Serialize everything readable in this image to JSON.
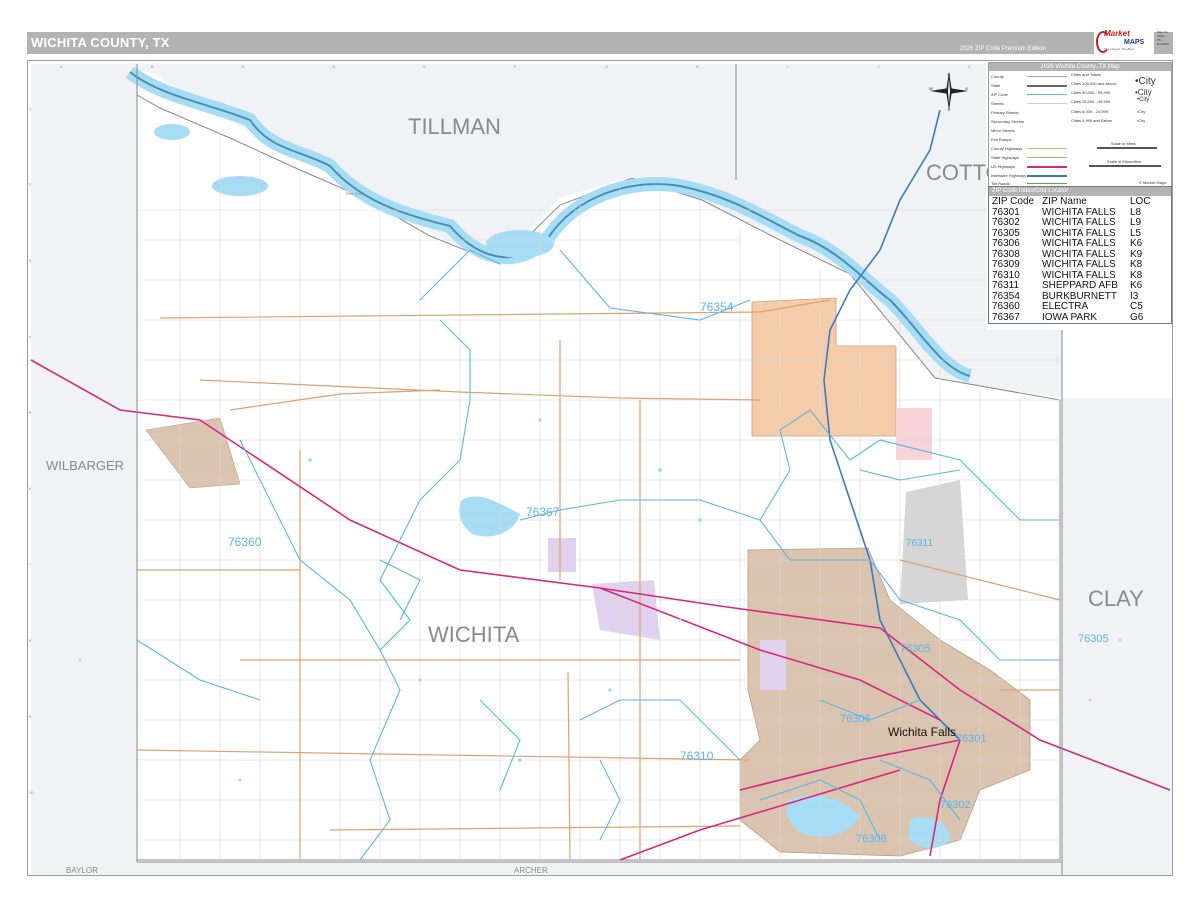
{
  "header": {
    "title": "WICHITA COUNTY, TX",
    "subtitle": "2026 ZIP Code Premium Edition"
  },
  "logo": {
    "word": "Market",
    "maps": "MAPS",
    "tagline": "The Largest. The Best."
  },
  "corner_note": [
    "Map No.",
    "Order",
    "Ph",
    "D-12450"
  ],
  "map": {
    "counties": [
      {
        "name": "TILLMAN",
        "size": 22
      },
      {
        "name": "COTTO",
        "size": 22
      },
      {
        "name": "WILBARGER",
        "size": 13
      },
      {
        "name": "CLAY",
        "size": 22
      },
      {
        "name": "WICHITA",
        "size": 22
      },
      {
        "name": "BAYLOR",
        "size": 8
      },
      {
        "name": "ARCHER",
        "size": 8
      }
    ],
    "zip_labels": [
      "76354",
      "76367",
      "76360",
      "76311",
      "76305",
      "76305",
      "76306",
      "76310",
      "76301",
      "76302",
      "76308"
    ],
    "city_label": "Wichita Falls",
    "grid_letters": [
      "A",
      "B",
      "C",
      "D",
      "E",
      "F",
      "G",
      "H",
      "I",
      "J",
      "K",
      "L",
      "M"
    ],
    "grid_numbers": [
      "1",
      "2",
      "3",
      "4",
      "5",
      "6",
      "7",
      "8",
      "9",
      "10"
    ],
    "lake_label": "Red River"
  },
  "legend": {
    "title": "2026 Wichita County, TX Map",
    "items": [
      "County",
      "State",
      "ZIP Code",
      "Streets",
      "Primary Streets",
      "Secondary Streets",
      "Minor Streets",
      "Exit Ramps",
      "County Highways",
      "State Highways",
      "US Highways",
      "Interstate Highways",
      "Toll Roads"
    ],
    "city_sizes_title": "Cities and Towns",
    "city_sizes": [
      {
        "label": "Cities 100,000 and Above",
        "sample": "•City"
      },
      {
        "label": "Cities 50,000 - 99,999",
        "sample": "•City"
      },
      {
        "label": "Cities 25,000 - 49,999",
        "sample": "•City"
      },
      {
        "label": "Cities 5,000 - 24,999",
        "sample": "•City"
      },
      {
        "label": "Cities 4,999 and Below",
        "sample": "•City"
      }
    ],
    "scale_miles": "Scale in Miles",
    "scale_km": "Scale in Kilometers",
    "copyright": "© Market Maps"
  },
  "zip_index": {
    "title": "ZIP Code Index/Grid Locator",
    "columns": [
      "ZIP Code",
      "ZIP Name",
      "LOC"
    ],
    "rows": [
      [
        "76301",
        "WICHITA FALLS",
        "L8"
      ],
      [
        "76302",
        "WICHITA FALLS",
        "L9"
      ],
      [
        "76305",
        "WICHITA FALLS",
        "L5"
      ],
      [
        "76306",
        "WICHITA FALLS",
        "K6"
      ],
      [
        "76308",
        "WICHITA FALLS",
        "K9"
      ],
      [
        "76309",
        "WICHITA FALLS",
        "K8"
      ],
      [
        "76310",
        "WICHITA FALLS",
        "K8"
      ],
      [
        "76311",
        "SHEPPARD AFB",
        "K6"
      ],
      [
        "76354",
        "BURKBURNETT",
        "I3"
      ],
      [
        "76360",
        "ELECTRA",
        "C5"
      ],
      [
        "76367",
        "IOWA PARK",
        "G6"
      ]
    ]
  },
  "colors": {
    "water": "#a7dcf5",
    "river_edge": "#4a8fb0",
    "zip_boundary": "#5bb6e6",
    "county_bg": "#f1f2f5",
    "urban_wf": "#dac4b0",
    "urban_burk": "#f5ccaa",
    "us_highway": "#d6287e",
    "state_highway": "#e0a070",
    "interstate": "#3a7bbf",
    "airbase": "#d6d6d6",
    "pink_zone": "#f8d4d8",
    "lilac_zone": "#e0d2ec"
  }
}
